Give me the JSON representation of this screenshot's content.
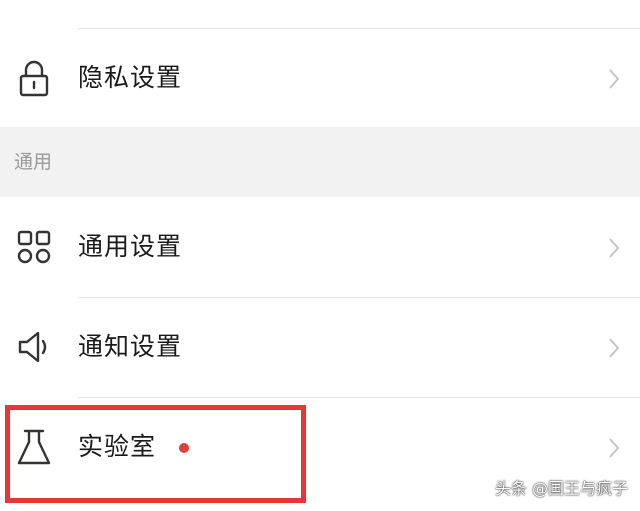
{
  "menu": {
    "privacy": {
      "label": "隐私设置",
      "icon": "lock-icon"
    },
    "section_general": {
      "title": "通用"
    },
    "general": {
      "label": "通用设置",
      "icon": "grid-icon"
    },
    "notifications": {
      "label": "通知设置",
      "icon": "speaker-icon"
    },
    "lab": {
      "label": "实验室",
      "icon": "flask-icon",
      "has_badge": true
    }
  },
  "watermark": {
    "text": "头条 @国王与疯子"
  },
  "colors": {
    "accent_red": "#e8353b",
    "badge_red": "#e0403a",
    "section_bg": "#f2f2f2",
    "text": "#1a1a1a",
    "muted": "#9a9a9a"
  }
}
